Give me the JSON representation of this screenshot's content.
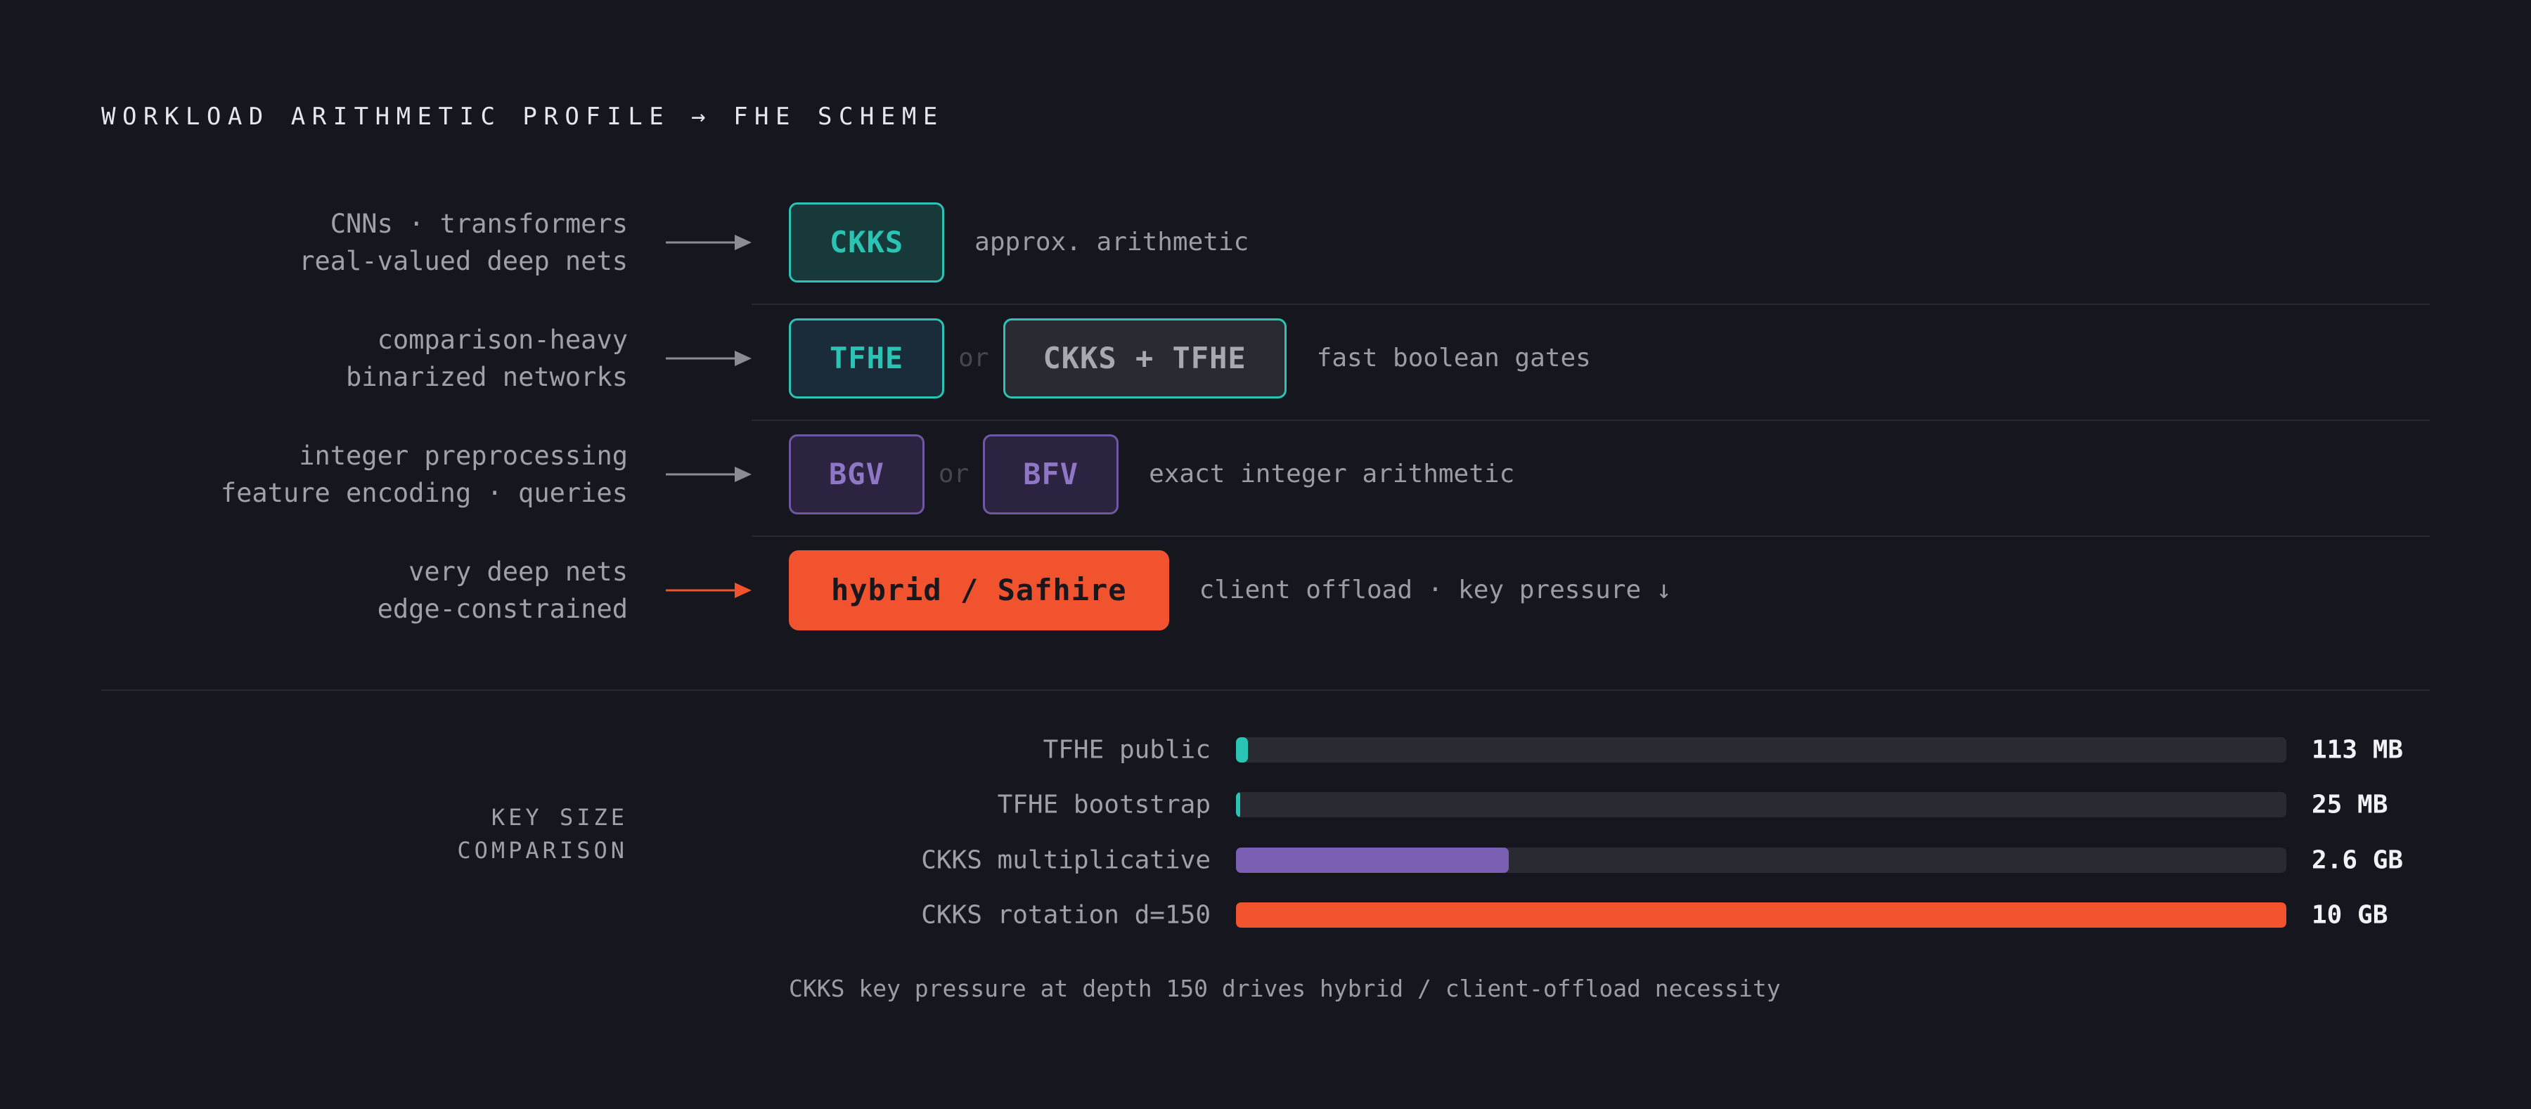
{
  "title": "WORKLOAD ARITHMETIC PROFILE → FHE SCHEME",
  "colors": {
    "background": "#16171e",
    "teal": "#2ac3b4",
    "purple": "#7b5fb3",
    "orange": "#f0532e",
    "grey_arrow": "#8c8c96"
  },
  "rows": [
    {
      "lines": [
        "CNNs · transformers",
        "real-valued deep nets"
      ],
      "arrow_color": "grey",
      "chips": [
        {
          "label": "CKKS",
          "style": "teal"
        }
      ],
      "separator": "",
      "description": "approx. arithmetic"
    },
    {
      "lines": [
        "comparison-heavy",
        "binarized networks"
      ],
      "arrow_color": "grey",
      "chips": [
        {
          "label": "TFHE",
          "style": "teal-dark"
        },
        {
          "label": "CKKS + TFHE",
          "style": "grey"
        }
      ],
      "separator": "or",
      "description": "fast boolean gates"
    },
    {
      "lines": [
        "integer preprocessing",
        "feature encoding · queries"
      ],
      "arrow_color": "grey",
      "chips": [
        {
          "label": "BGV",
          "style": "purple"
        },
        {
          "label": "BFV",
          "style": "purple"
        }
      ],
      "separator": "or",
      "description": "exact integer arithmetic"
    },
    {
      "lines": [
        "very deep nets",
        "edge-constrained"
      ],
      "arrow_color": "orange",
      "chips": [
        {
          "label": "hybrid / Safhire",
          "style": "solid"
        }
      ],
      "separator": "",
      "description": "client offload · key pressure ↓"
    }
  ],
  "key_sizes": {
    "label_lines": [
      "KEY SIZE",
      "COMPARISON"
    ],
    "scale_max_gb": 10,
    "bars": [
      {
        "label": "TFHE public",
        "value": "113 MB",
        "size_gb": 0.113,
        "color": "#2ac3b4"
      },
      {
        "label": "TFHE bootstrap",
        "value": "25 MB",
        "size_gb": 0.025,
        "color": "#2ac3b4"
      },
      {
        "label": "CKKS multiplicative",
        "value": "2.6 GB",
        "size_gb": 2.6,
        "color": "#7b5fb3"
      },
      {
        "label": "CKKS rotation d=150",
        "value": "10 GB",
        "size_gb": 10,
        "color": "#f0532e"
      }
    ]
  },
  "footnote": "CKKS key pressure at depth 150 drives hybrid / client-offload necessity"
}
